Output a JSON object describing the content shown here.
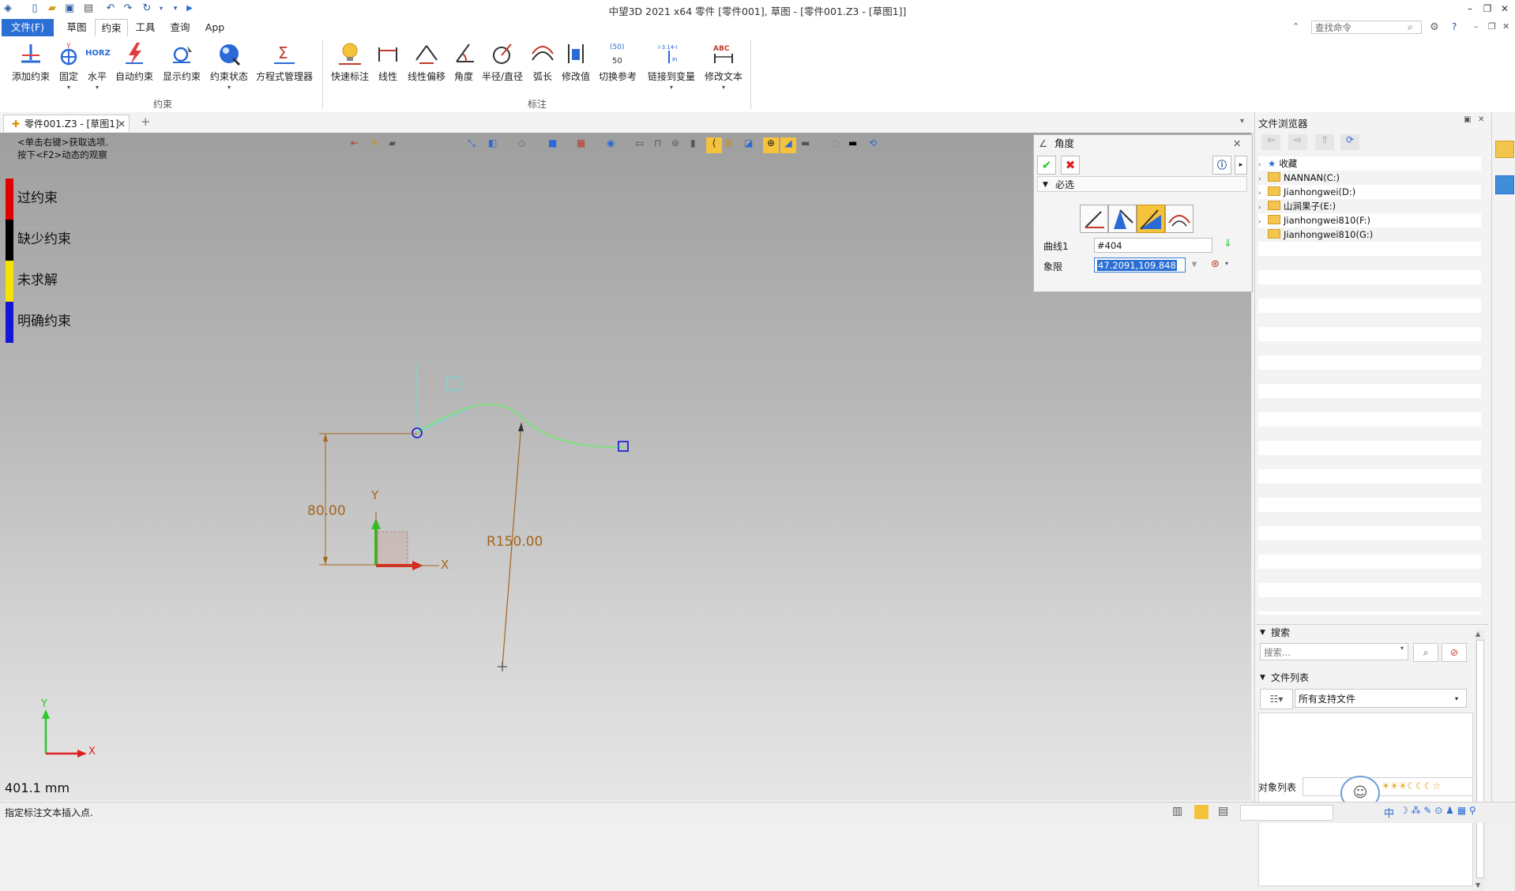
{
  "app": {
    "title": "中望3D 2021 x64      零件 [零件001], 草图 - [零件001.Z3 - [草图1]]"
  },
  "menu": {
    "file": "文件(F)",
    "items": [
      "草图",
      "约束",
      "工具",
      "查询",
      "App"
    ],
    "active_index": 1,
    "search_placeholder": "查找命令"
  },
  "ribbon": {
    "group1": {
      "label": "约束",
      "buttons": [
        "添加约束",
        "固定",
        "水平",
        "自动约束",
        "显示约束",
        "约束状态",
        "方程式管理器"
      ]
    },
    "group2": {
      "label": "标注",
      "buttons": [
        "快速标注",
        "线性",
        "线性偏移",
        "角度",
        "半径/直径",
        "弧长",
        "修改值",
        "切换参考",
        "链接到变量",
        "修改文本"
      ]
    },
    "icon_text": {
      "horz": "HORZ",
      "sigma": "Σ",
      "abc": "ABC",
      "paren50": "(50)",
      "val50": "50",
      "link": "I-3.14-I",
      "pi": "PI",
      "y": "Y"
    }
  },
  "document": {
    "tab_label": "零件001.Z3 - [草图1]",
    "close_glyph": "✕",
    "add_glyph": "+"
  },
  "viewport": {
    "hint_line1": "<单击右键>获取选项.",
    "hint_line2": "按下<F2>动态的观察",
    "legend": [
      {
        "label": "过约束",
        "color": "#e00000"
      },
      {
        "label": "缺少约束",
        "color": "#000000"
      },
      {
        "label": "未求解",
        "color": "#f2e400"
      },
      {
        "label": "明确约束",
        "color": "#1515d8"
      }
    ],
    "dim_linear": "80.00",
    "dim_radius": "R150.00",
    "axis_x": "X",
    "axis_y": "Y",
    "scale_readout": "401.1 mm",
    "colors": {
      "dimension": "#a4651e",
      "curve": "#7ee07e",
      "preview": "#6fdcdc"
    }
  },
  "angle_panel": {
    "title": "角度",
    "section": "必选",
    "curve_label": "曲线1",
    "curve_value": "#404",
    "quadrant_label": "象限",
    "quadrant_value": "47.2091,109.848",
    "close_glyph": "✕",
    "ok_glyph": "✔",
    "cancel_glyph": "✖"
  },
  "file_browser": {
    "title": "文件浏览器",
    "tree": [
      {
        "label": "收藏",
        "icon": "star-icon"
      },
      {
        "label": "NANNAN(C:)",
        "icon": "folder-icon"
      },
      {
        "label": "Jianhongwei(D:)",
        "icon": "folder-icon"
      },
      {
        "label": "山涧果子(E:)",
        "icon": "folder-icon"
      },
      {
        "label": "Jianhongwei810(F:)",
        "icon": "folder-icon"
      },
      {
        "label": "Jianhongwei810(G:)",
        "icon": "folder-icon"
      }
    ],
    "search_title": "搜索",
    "search_placeholder": "搜索...",
    "filelist_title": "文件列表",
    "filter_value": "所有支持文件",
    "object_list": "对象列表"
  },
  "statusbar": {
    "message": "指定标注文本插入点.",
    "ime_text": "中"
  }
}
